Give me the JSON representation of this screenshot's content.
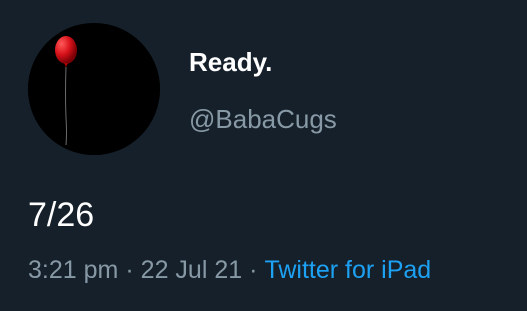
{
  "user": {
    "display_name": "Ready.",
    "handle": "@BabaCugs",
    "avatar_icon": "red-balloon-icon"
  },
  "tweet": {
    "text": "7/26",
    "time": "3:21 pm",
    "date": "22 Jul 21",
    "separator": "·",
    "source": "Twitter for iPad"
  },
  "colors": {
    "background": "#15202b",
    "primary_text": "#ffffff",
    "secondary_text": "#8899a6",
    "link": "#1da1f2",
    "balloon": "#d8121a"
  }
}
